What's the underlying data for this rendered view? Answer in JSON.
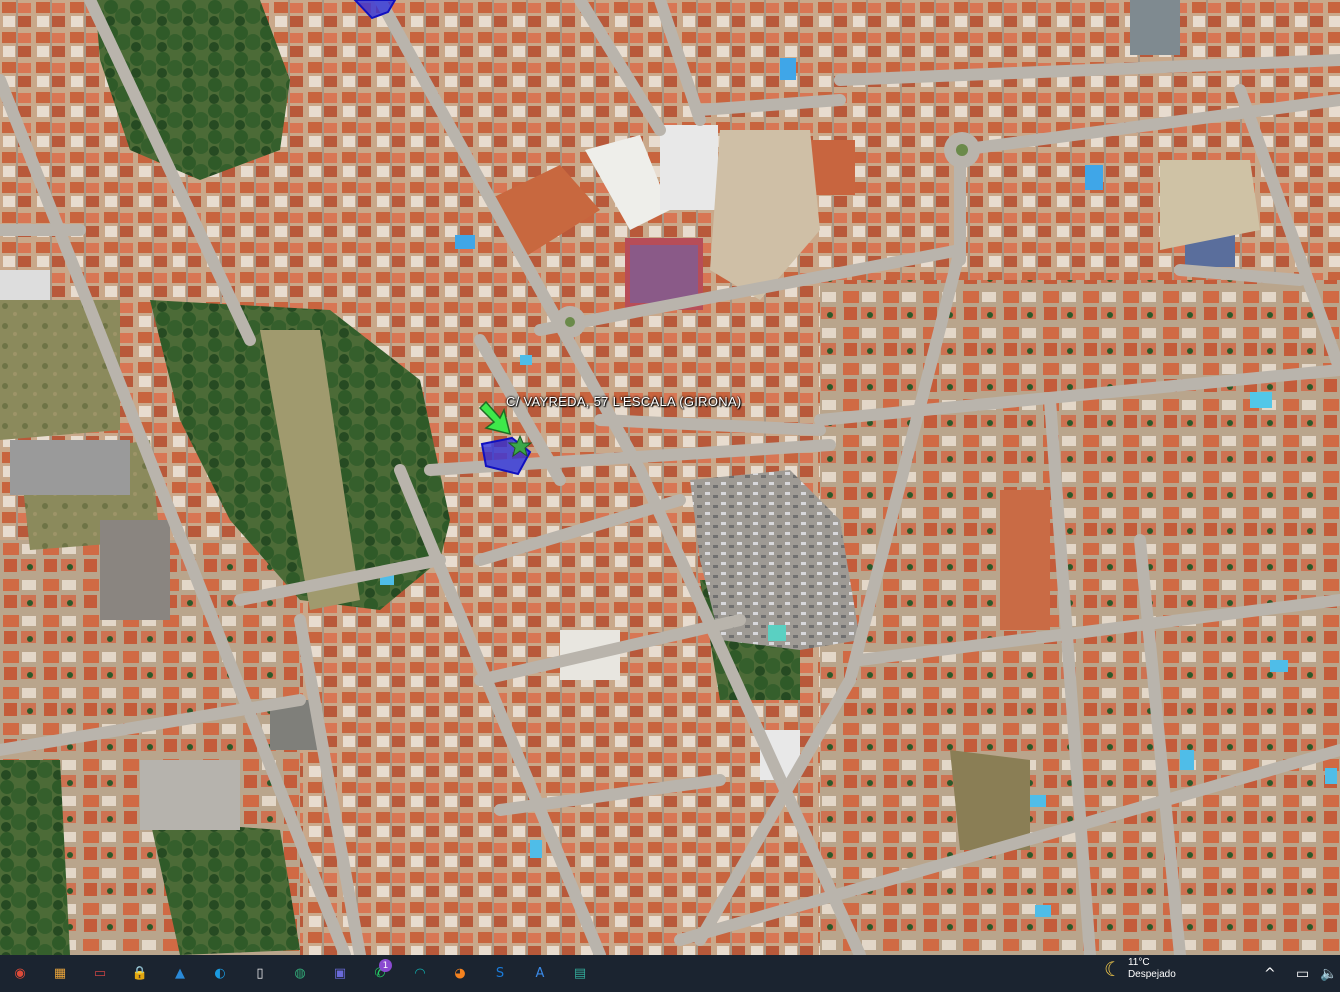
{
  "map": {
    "label": "C/ VAYREDA, 57  L'ESCALA (GIRONA)",
    "colors": {
      "arrow": "#3ee84a",
      "parcel": "#2a2ee0",
      "star": "#3aa84a"
    }
  },
  "taskbar": {
    "icons": [
      {
        "name": "chrome-icon",
        "glyph": "◉",
        "color": "#dd4b39"
      },
      {
        "name": "photos-icon",
        "glyph": "▦",
        "color": "#e8a33a"
      },
      {
        "name": "file-explorer-icon",
        "glyph": "▭",
        "color": "#c44"
      },
      {
        "name": "lock-app-icon",
        "glyph": "🔒",
        "color": "#3a6"
      },
      {
        "name": "landscape-app-icon",
        "glyph": "▲",
        "color": "#2a8ad8"
      },
      {
        "name": "edge-icon",
        "glyph": "◐",
        "color": "#1a9ae0"
      },
      {
        "name": "document-icon",
        "glyph": "▯",
        "color": "#eee"
      },
      {
        "name": "globe-icon",
        "glyph": "◍",
        "color": "#3a7"
      },
      {
        "name": "save-disk-icon",
        "glyph": "▣",
        "color": "#6a6ad8"
      },
      {
        "name": "whatsapp-icon",
        "glyph": "✆",
        "color": "#25d366",
        "badge": "1"
      },
      {
        "name": "wave-app-icon",
        "glyph": "◠",
        "color": "#1aa"
      },
      {
        "name": "firefox-icon",
        "glyph": "◕",
        "color": "#f5821f"
      },
      {
        "name": "s-app-icon",
        "glyph": "S",
        "color": "#1a7ad8"
      },
      {
        "name": "a-app-icon",
        "glyph": "A",
        "color": "#3a8ae8"
      },
      {
        "name": "monitor-app-icon",
        "glyph": "▤",
        "color": "#3a9"
      }
    ],
    "weather": {
      "temp": "11°C",
      "condition": "Despejado"
    },
    "tray": {
      "chevron": "^",
      "display": "▭",
      "volume": "🔈"
    }
  }
}
